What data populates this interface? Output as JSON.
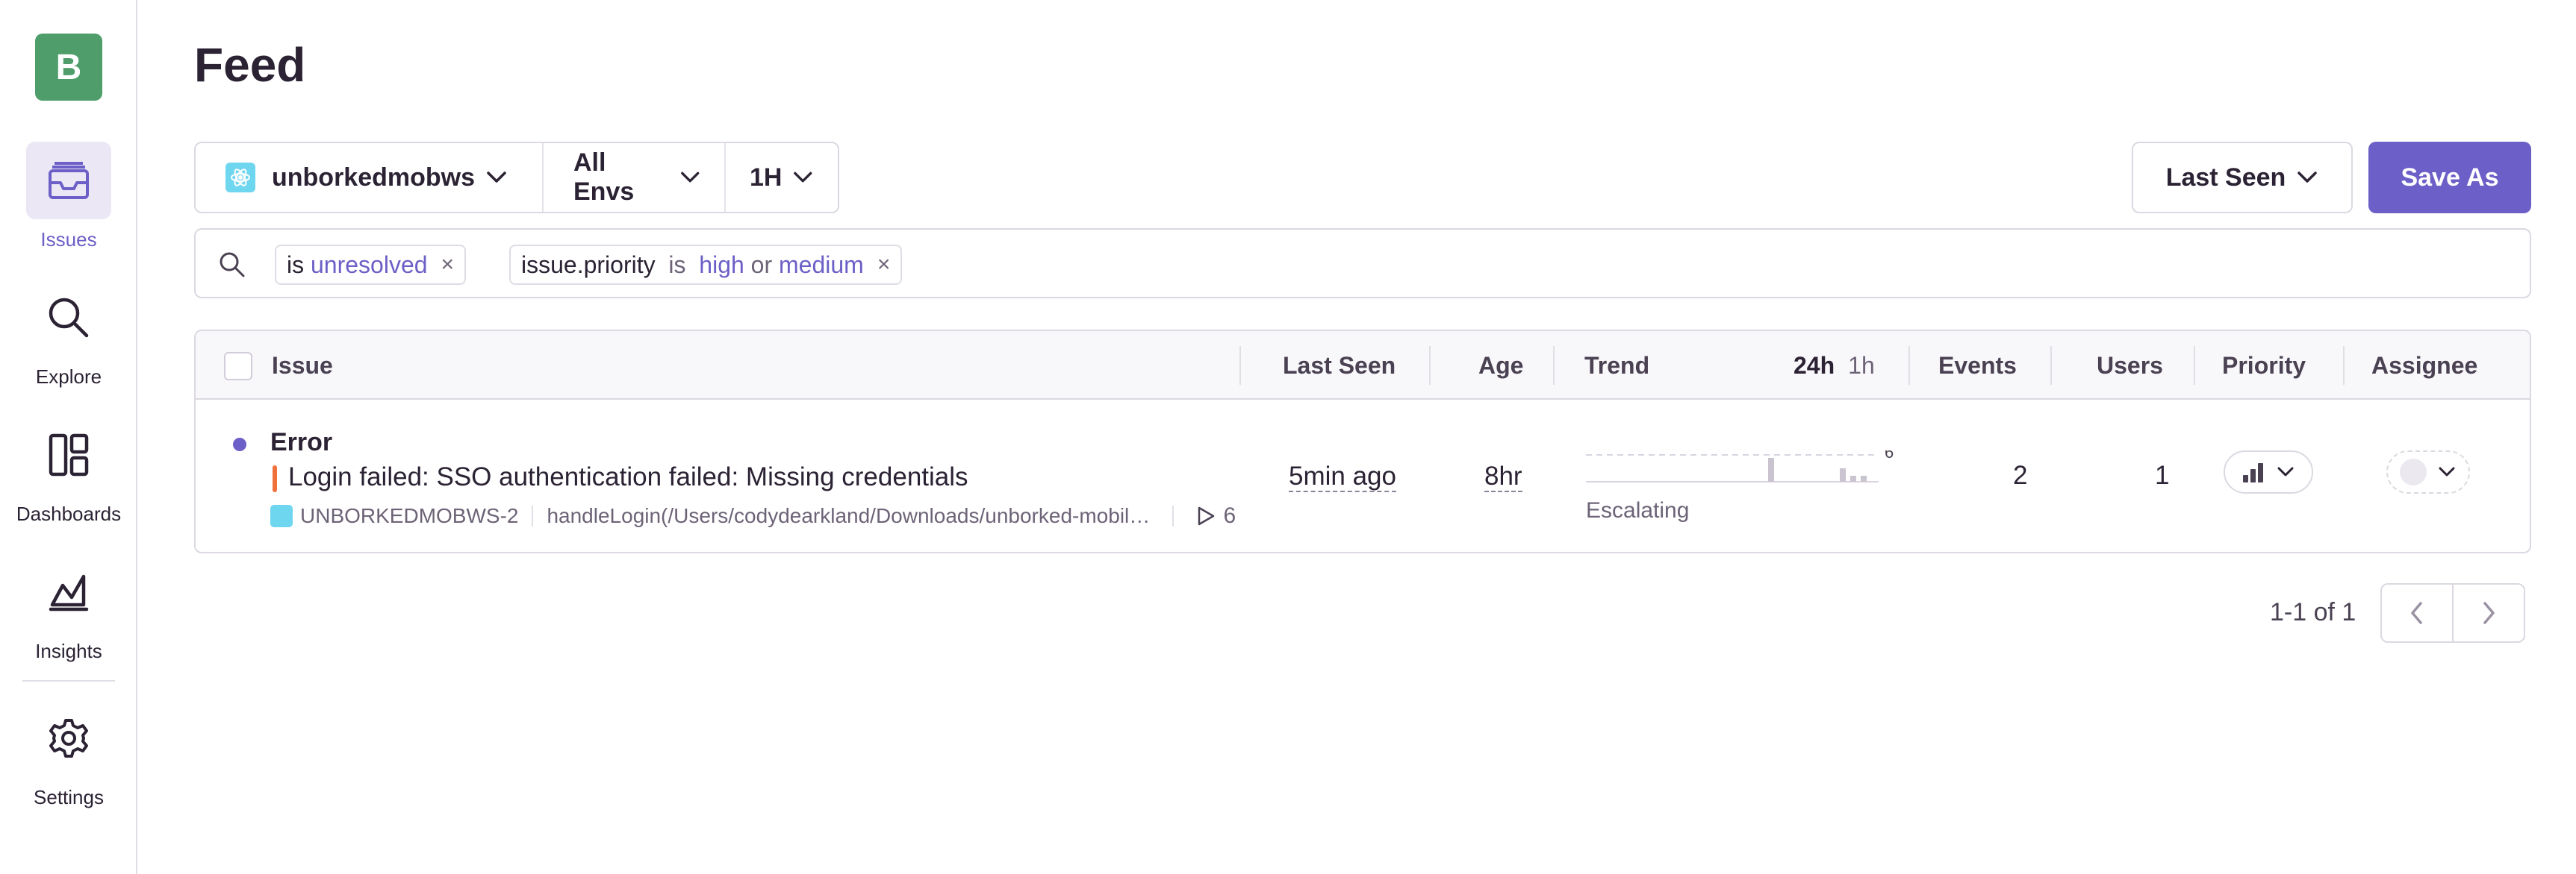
{
  "org": {
    "initial": "B",
    "color": "#4e9d6a"
  },
  "accent_color": "#6c5fc7",
  "sidebar": {
    "items": [
      {
        "label": "Issues",
        "icon": "issues-icon",
        "active": true
      },
      {
        "label": "Explore",
        "icon": "search-icon"
      },
      {
        "label": "Dashboards",
        "icon": "dashboards-icon"
      },
      {
        "label": "Insights",
        "icon": "insights-icon"
      },
      {
        "label": "Settings",
        "icon": "gear-icon"
      }
    ]
  },
  "page": {
    "title": "Feed"
  },
  "filters": {
    "project": "unborkedmobws",
    "environment": "All Envs",
    "time_range": "1H"
  },
  "sort": {
    "label": "Last Seen"
  },
  "save_button": "Save As",
  "search": {
    "tokens": [
      {
        "key": "is",
        "value": "unresolved"
      },
      {
        "key": "issue.priority",
        "op": "is",
        "value1": "high",
        "connector": "or",
        "value2": "medium"
      }
    ],
    "close_glyph": "×"
  },
  "table": {
    "columns": {
      "issue": "Issue",
      "last_seen": "Last Seen",
      "age": "Age",
      "trend": "Trend",
      "trend_24h": "24h",
      "trend_1h": "1h",
      "events": "Events",
      "users": "Users",
      "priority": "Priority",
      "assignee": "Assignee"
    },
    "rows": [
      {
        "type": "Error",
        "message": "Login failed: SSO authentication failed: Missing credentials",
        "short_id": "UNBORKEDMOBWS-2",
        "culprit": "handleLogin(/Users/codydearkland/Downloads/unborked-mobile-web-sdk/src/...",
        "replays": "6",
        "last_seen": "5min ago",
        "age": "8hr",
        "trend_max": "6",
        "trend_status": "Escalating",
        "events": "2",
        "users": "1",
        "level_color": "#f1713b"
      }
    ]
  },
  "pagination": {
    "text": "1-1 of 1"
  }
}
